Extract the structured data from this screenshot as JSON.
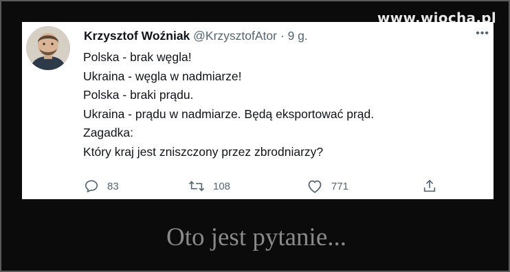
{
  "watermark": "www.wiocha.pl",
  "tweet": {
    "author_name": "Krzysztof Woźniak",
    "handle": "@KrzysztofAtor",
    "separator": "·",
    "time": "9 g.",
    "lines": [
      "Polska - brak węgla!",
      "Ukraina - węgla w nadmiarze!",
      "Polska - braki prądu.",
      "Ukraina - prądu w nadmiarze. Będą eksportować prąd.",
      "Zagadka:",
      "Który kraj jest zniszczony przez zbrodniarzy?"
    ],
    "actions": {
      "reply_count": "83",
      "retweet_count": "108",
      "like_count": "771"
    }
  },
  "caption": "Oto jest pytanie...",
  "icons": [
    "more-icon",
    "reply-icon",
    "retweet-icon",
    "like-icon",
    "share-icon"
  ]
}
